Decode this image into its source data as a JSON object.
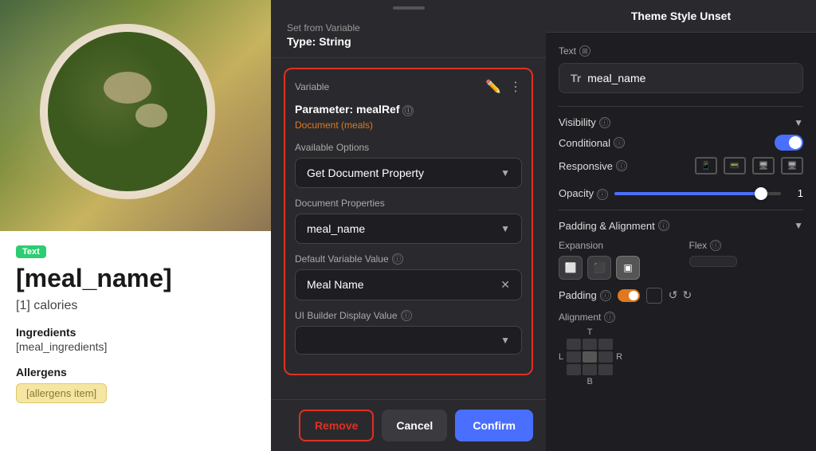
{
  "left": {
    "text_badge": "Text",
    "meal_name_display": "[meal_name]",
    "calories": "[1] calories",
    "ingredients_label": "Ingredients",
    "ingredients_value": "[meal_ingredients]",
    "allergens_label": "Allergens",
    "allergens_badge": "[allergens item]"
  },
  "modal": {
    "drag_handle": "",
    "set_from_variable": "Set from Variable",
    "type_string": "Type: String",
    "variable_section_label": "Variable",
    "parameter_name": "Parameter: mealRef",
    "info_icon": "ⓘ",
    "document_source": "Document (meals)",
    "available_options_label": "Available Options",
    "available_options_value": "Get Document Property",
    "document_properties_label": "Document Properties",
    "document_properties_value": "meal_name",
    "default_variable_label": "Default Variable Value",
    "default_variable_icon": "ⓘ",
    "default_variable_value": "Meal Name",
    "ui_builder_label": "UI Builder Display Value",
    "ui_builder_icon": "ⓘ",
    "ui_builder_placeholder": "",
    "btn_remove": "Remove",
    "btn_cancel": "Cancel",
    "btn_confirm": "Confirm"
  },
  "right": {
    "theme_style_title": "Theme Style Unset",
    "text_label": "Text",
    "text_value": "meal_name",
    "text_type_icon": "Tr",
    "visibility_label": "Visibility",
    "conditional_label": "Conditional",
    "responsive_label": "Responsive",
    "opacity_label": "Opacity",
    "opacity_value": "1",
    "padding_alignment_label": "Padding & Alignment",
    "expansion_label": "Expansion",
    "flex_label": "Flex",
    "flex_icon": "ⓘ",
    "padding_label": "Padding",
    "padding_icon": "ⓘ",
    "alignment_label": "Alignment",
    "alignment_icon": "ⓘ",
    "info_icon": "ⓘ",
    "chevron_label": "chevron"
  }
}
